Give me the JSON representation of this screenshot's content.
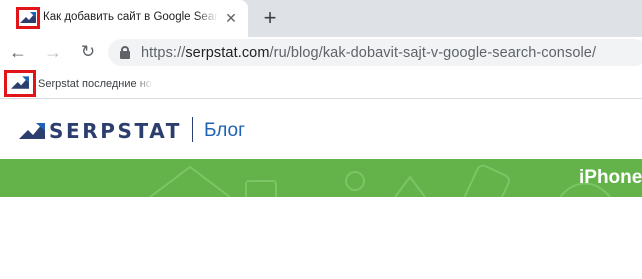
{
  "tab": {
    "title": "Как добавить сайт в Google Search",
    "close_symbol": "✕",
    "favicon": "serpstat-logo-icon"
  },
  "new_tab_symbol": "+",
  "toolbar": {
    "back_symbol": "←",
    "forward_symbol": "→",
    "reload_symbol": "↻",
    "url_scheme": "https://",
    "url_host": "serpstat.com",
    "url_path": "/ru/blog/kak-dobavit-sajt-v-google-search-console/"
  },
  "bookmarks": {
    "items": [
      {
        "label": "Serpstat последние но",
        "icon": "serpstat-logo-icon"
      }
    ]
  },
  "site": {
    "logo_text": "SERPSTAT",
    "section_label": "Блог",
    "brand_color": "#2c3e6e",
    "accent_color": "#1e63b3",
    "highlight_color": "#e1141a"
  },
  "banner": {
    "text": "iPhone",
    "color": "#63b34a"
  }
}
